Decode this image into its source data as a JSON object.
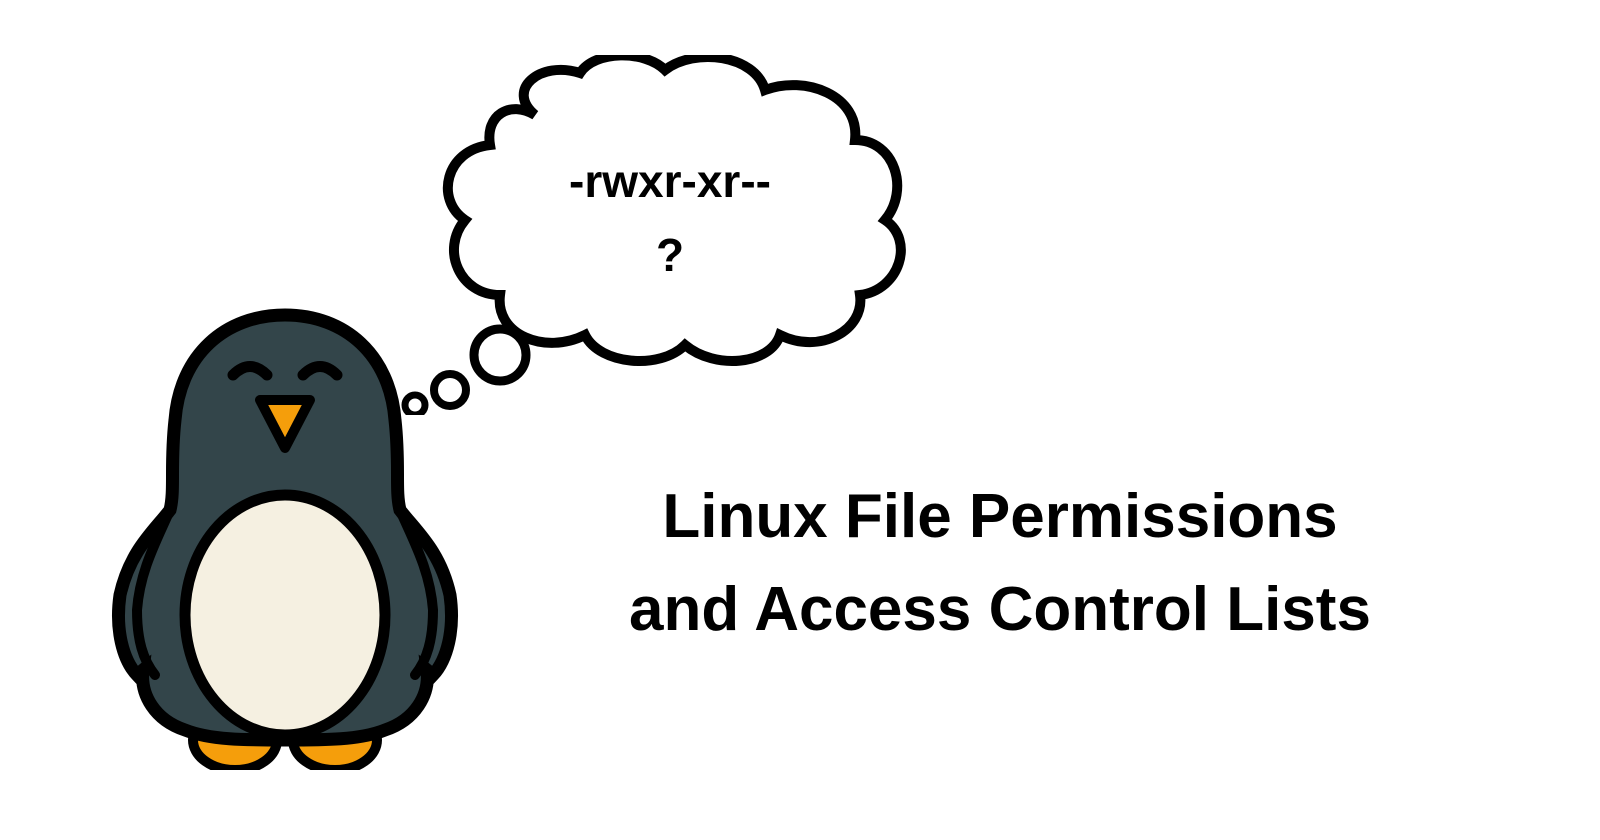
{
  "bubble": {
    "line1": "-rwxr-xr--",
    "line2": "?"
  },
  "title": {
    "line1": "Linux File Permissions",
    "line2": "and Access Control Lists"
  },
  "colors": {
    "penguin_body": "#33454a",
    "penguin_belly": "#f5f0e1",
    "penguin_beak": "#f59e0b",
    "penguin_feet": "#f59e0b",
    "outline": "#000000"
  }
}
